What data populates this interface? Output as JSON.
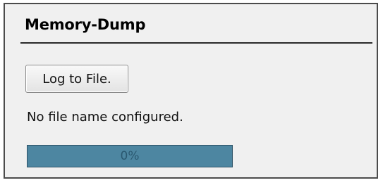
{
  "panel": {
    "title": "Memory-Dump",
    "log_button_label": "Log to File.",
    "status_text": "No file name configured.",
    "progress": {
      "value": 0,
      "label": "0%"
    }
  }
}
